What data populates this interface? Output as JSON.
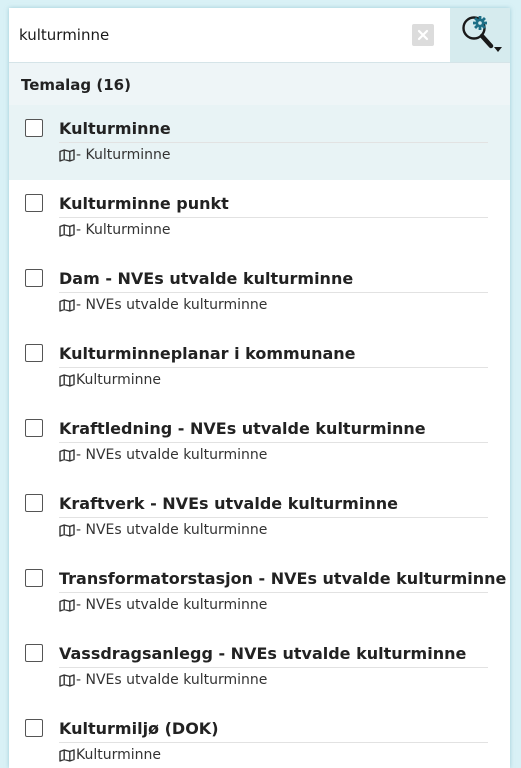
{
  "search": {
    "value": "kulturminne",
    "clear_icon": "close-icon",
    "options_icon": "gear-search-icon"
  },
  "category": {
    "label": "Temalag (16)"
  },
  "results": [
    {
      "title": "Kulturminne",
      "subtitle": "- Kulturminne",
      "icon": "map-icon",
      "highlighted": true
    },
    {
      "title": "Kulturminne punkt",
      "subtitle": "- Kulturminne",
      "icon": "map-icon"
    },
    {
      "title": "Dam - NVEs utvalde kulturminne",
      "subtitle": "- NVEs utvalde kulturminne",
      "icon": "map-icon"
    },
    {
      "title": "Kulturminneplanar i kommunane",
      "subtitle": "Kulturminne",
      "icon": "map-icon"
    },
    {
      "title": "Kraftledning - NVEs utvalde kulturminne",
      "subtitle": "- NVEs utvalde kulturminne",
      "icon": "map-icon"
    },
    {
      "title": "Kraftverk - NVEs utvalde kulturminne",
      "subtitle": "- NVEs utvalde kulturminne",
      "icon": "map-icon"
    },
    {
      "title": "Transformatorstasjon - NVEs utvalde kulturminne",
      "subtitle": "- NVEs utvalde kulturminne",
      "icon": "map-icon"
    },
    {
      "title": "Vassdragsanlegg - NVEs utvalde kulturminne",
      "subtitle": "- NVEs utvalde kulturminne",
      "icon": "map-icon"
    },
    {
      "title": "Kulturmiljø (DOK)",
      "subtitle": "Kulturminne",
      "icon": "map-icon"
    }
  ],
  "colors": {
    "accent": "#1d6f86",
    "highlight": "#e8f3f5",
    "header_bg": "#eef5f7"
  }
}
